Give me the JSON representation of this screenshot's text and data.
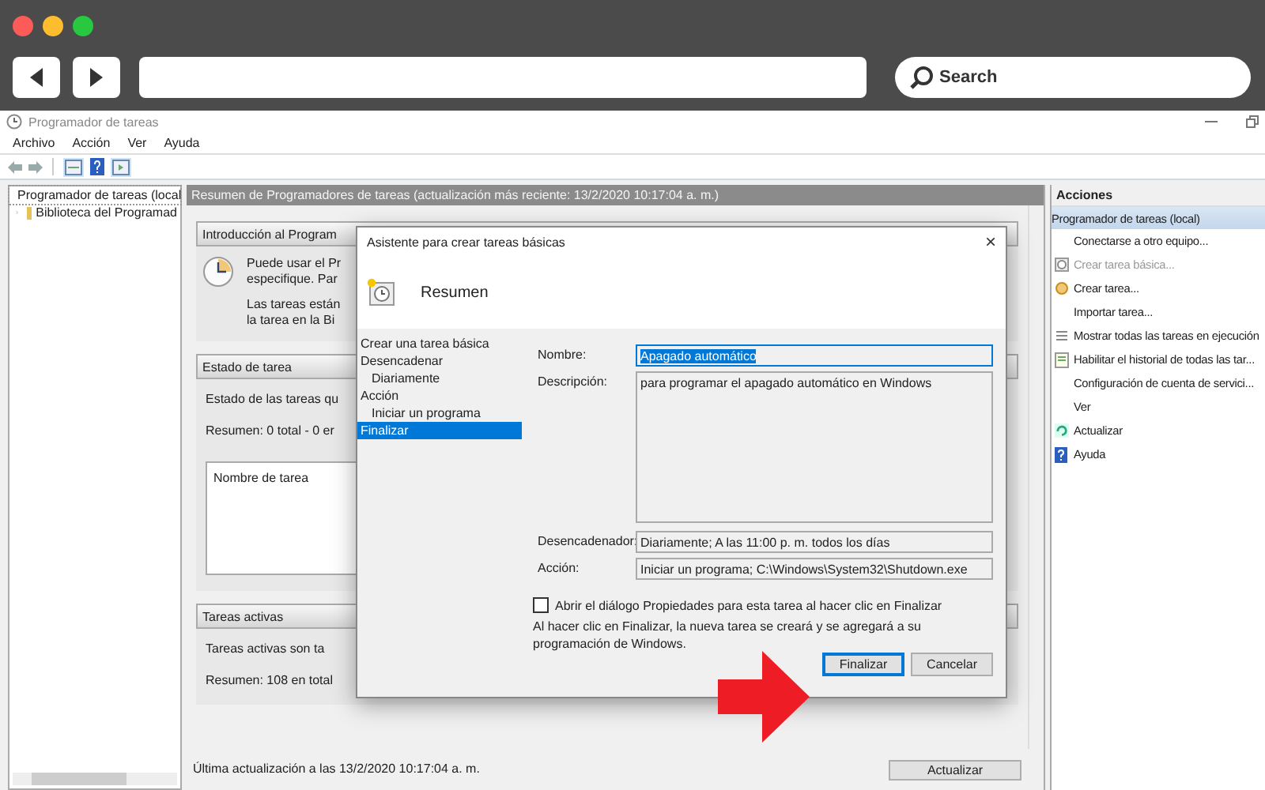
{
  "search": {
    "placeholder": "Search"
  },
  "window": {
    "title": "Programador de tareas"
  },
  "menu": [
    "Archivo",
    "Acción",
    "Ver",
    "Ayuda"
  ],
  "tree": [
    {
      "label": "Programador de tareas (local",
      "selected": true,
      "expanded": true,
      "children": [
        {
          "label": "Biblioteca del Programad",
          "selected": false,
          "expanded": false
        }
      ]
    }
  ],
  "summary": {
    "header": "Resumen de Programadores de tareas (actualización más reciente: 13/2/2020 10:17:04 a. m.)",
    "intro": {
      "title": "Introducción al Program",
      "lines": [
        "Puede usar el Pr",
        "especifique. Par"
      ],
      "lines_2": [
        "Las tareas están",
        "la tarea en la Bi"
      ]
    },
    "status": {
      "title": "Estado de tarea",
      "lines": [
        "Estado de las tareas qu",
        "Resumen: 0 total - 0 er"
      ],
      "list_heading": "Nombre de tarea"
    },
    "active": {
      "title": "Tareas activas",
      "lines": [
        "Tareas activas son ta",
        "Resumen: 108 en total"
      ]
    },
    "last_update": "Última actualización a las 13/2/2020 10:17:04 a. m.",
    "refresh_button": "Actualizar"
  },
  "actions": {
    "title": "Acciones",
    "items": [
      {
        "label": "Programador de tareas (local)",
        "kind": "group",
        "disabled": false
      },
      {
        "label": "Conectarse a otro equipo...",
        "kind": "plain",
        "disabled": false
      },
      {
        "label": "Crear tarea básica...",
        "kind": "wizard",
        "disabled": true
      },
      {
        "label": "Crear tarea...",
        "kind": "task",
        "disabled": false
      },
      {
        "label": "Importar tarea...",
        "kind": "plain",
        "disabled": false
      },
      {
        "label": "Mostrar todas las tareas en ejecución",
        "kind": "list",
        "disabled": false
      },
      {
        "label": "Habilitar el historial de todas las tar...",
        "kind": "history",
        "disabled": false
      },
      {
        "label": "Configuración de cuenta de servici...",
        "kind": "plain",
        "disabled": false
      },
      {
        "label": "Ver",
        "kind": "plain",
        "disabled": false
      },
      {
        "label": "Actualizar",
        "kind": "refresh",
        "disabled": false
      },
      {
        "label": "Ayuda",
        "kind": "help",
        "disabled": false
      }
    ]
  },
  "dialog": {
    "title": "Asistente para crear tareas básicas",
    "close": "×",
    "heading": "Resumen",
    "steps": [
      {
        "label": "Crear una tarea básica",
        "selected": false
      },
      {
        "label": "Desencadenar",
        "selected": false,
        "children": [
          {
            "label": "Diariamente",
            "selected": false
          }
        ]
      },
      {
        "label": "Acción",
        "selected": false,
        "children": [
          {
            "label": "Iniciar un programa",
            "selected": false
          }
        ]
      },
      {
        "label": "Finalizar",
        "selected": true
      }
    ],
    "fields": [
      {
        "label": "Nombre:",
        "value": "Apagado automático",
        "kind": "input",
        "text_selected": true
      },
      {
        "label": "Descripción:",
        "value": "para programar el apagado automático en Windows",
        "kind": "textarea",
        "text_selected": false
      },
      {
        "label": "Desencadenador:",
        "value": "Diariamente; A las 11:00 p. m. todos los días",
        "kind": "input",
        "text_selected": false
      },
      {
        "label": "Acción:",
        "value": "Iniciar un programa; C:\\Windows\\System32\\Shutdown.exe",
        "kind": "input",
        "text_selected": false
      }
    ],
    "checkbox": {
      "label": "Abrir el diálogo Propiedades para esta tarea al hacer clic en Finalizar",
      "checked": false
    },
    "note": "Al hacer clic en Finalizar, la nueva tarea se creará y se agregará a su programación de Windows.",
    "buttons": [
      {
        "label": "Finalizar",
        "default": true
      },
      {
        "label": "Cancelar",
        "default": false
      }
    ]
  }
}
